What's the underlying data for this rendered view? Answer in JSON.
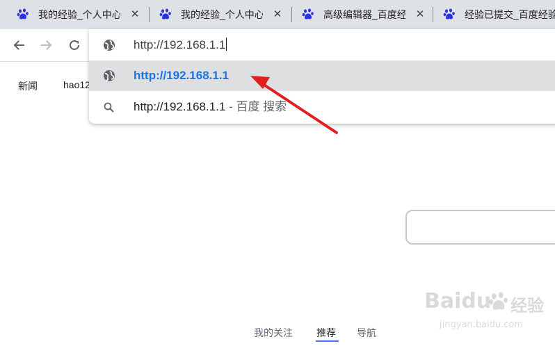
{
  "tabs": [
    {
      "title": "我的经验_个人中心",
      "close": "✕",
      "favicon": "baidu-paw-icon"
    },
    {
      "title": "我的经验_个人中心",
      "close": "✕",
      "favicon": "baidu-paw-icon"
    },
    {
      "title": "高级编辑器_百度经验",
      "close": "✕",
      "favicon": "baidu-paw-icon"
    },
    {
      "title": "经验已提交_百度经验",
      "close": "✕",
      "favicon": "baidu-paw-icon"
    }
  ],
  "toolbar": {
    "back_icon": "arrow-left-icon",
    "forward_icon": "arrow-right-icon",
    "reload_icon": "reload-icon"
  },
  "omnibox": {
    "input_value": "http://192.168.1.1",
    "suggestions": [
      {
        "text": "http://192.168.1.1",
        "icon": "globe-icon"
      },
      {
        "text": "http://192.168.1.1",
        "suffix": " - 百度 搜索",
        "icon": "search-icon"
      }
    ]
  },
  "bookmarks": [
    {
      "label": "新闻"
    },
    {
      "label": "hao12"
    }
  ],
  "bottom_tabs": [
    {
      "label": "我的关注"
    },
    {
      "label": "推荐"
    },
    {
      "label": "导航"
    }
  ],
  "watermark": {
    "brand": "Baidu",
    "brand_cn": "经验",
    "url": "jingyan.baidu.com"
  },
  "colors": {
    "tabstrip": "#dee1e6",
    "url_blue": "#1a73e8",
    "selected_row": "#dedfe1",
    "arrow_red": "#e02020",
    "active_underline": "#4e6ef2"
  }
}
